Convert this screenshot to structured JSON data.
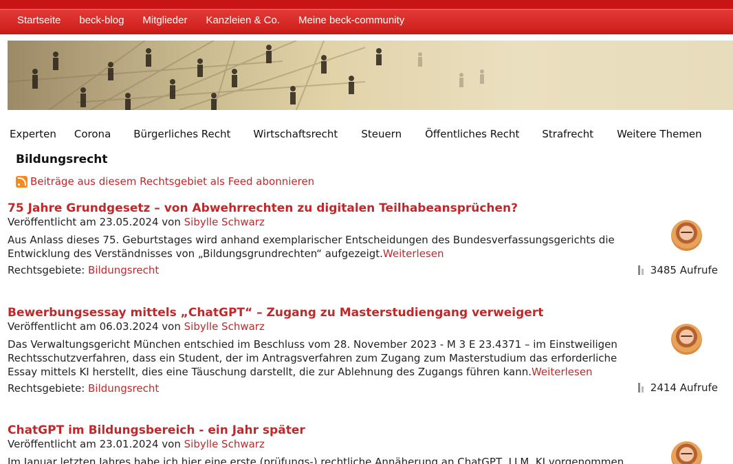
{
  "topnav": {
    "items": [
      "Startseite",
      "beck-blog",
      "Mitglieder",
      "Kanzleien & Co.",
      "Meine beck-community"
    ]
  },
  "catnav": {
    "items": [
      "Experten",
      "Corona",
      "Bürgerliches Recht",
      "Wirtschaftsrecht",
      "Steuern",
      "Öffentliches Recht",
      "Strafrecht",
      "Weitere Themen"
    ]
  },
  "page": {
    "title": "Bildungsrecht",
    "feed_link": "Beiträge aus diesem Rechtsgebiet als Feed abonnieren"
  },
  "labels": {
    "published": "Veröffentlicht am",
    "by": "von",
    "areas": "Rechtsgebiete:",
    "read_more": "Weiterlesen",
    "views_suffix": "Aufrufe"
  },
  "articles": [
    {
      "title": "75 Jahre Grundgesetz – von Abwehrrechten zu digitalen Teilhabeansprüchen?",
      "date": "23.05.2024",
      "author": "Sibylle Schwarz",
      "teaser": "Aus Anlass dieses 75. Geburtstages wird anhand exemplarischer Entscheidungen des Bundesverfassungsgerichts die Entwicklung des Verständnisses von „Bildungsgrundrechten“ aufgezeigt.",
      "area": "Bildungsrecht",
      "views": "3485"
    },
    {
      "title": "Bewerbungsessay mittels „ChatGPT“ – Zugang zu Masterstudiengang verweigert",
      "date": "06.03.2024",
      "author": "Sibylle Schwarz",
      "teaser": "Das Verwaltungsgericht München entschied im Beschluss vom 28. November 2023 - M 3 E 23.4371 – im Einstweiligen Rechtsschutzverfahren, dass ein Student, der im Antragsverfahren zum Zugang zum Masterstudium das erforderliche Essay mittels KI herstellt, dies eine Täuschung darstellt, die zur Ablehnung des Zugangs führen kann.",
      "area": "Bildungsrecht",
      "views": "2414"
    },
    {
      "title": "ChatGPT im Bildungsbereich - ein Jahr später",
      "date": "23.01.2024",
      "author": "Sibylle Schwarz",
      "teaser": "Im Januar letzten Jahres habe ich hier eine erste (prüfungs-) rechtliche Annäherung an ChatGPT, LLM, KI vorgenommen. Ein"
    }
  ]
}
